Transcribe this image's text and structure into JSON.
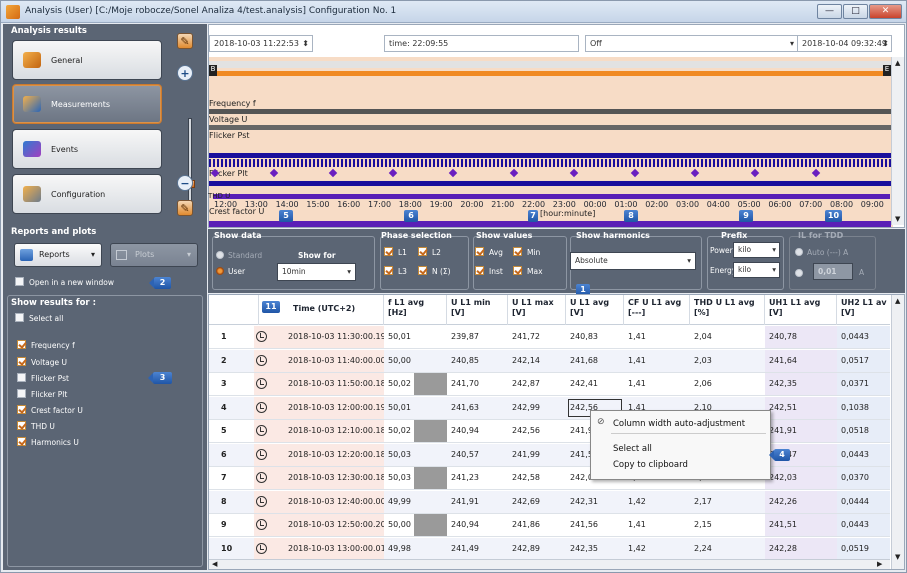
{
  "window": {
    "title": "Analysis (User) [C:/Moje robocze/Sonel Analiza 4/test.analysis] Configuration No. 1",
    "min": "—",
    "max": "□",
    "close": "✕"
  },
  "left": {
    "analysis_title": "Analysis results",
    "nav": [
      "General",
      "Measurements",
      "Events",
      "Configuration"
    ],
    "reports_title": "Reports and plots",
    "reports_btn": "Reports",
    "plots_btn": "Plots",
    "open_new_window": "Open in a new window",
    "show_results_title": "Show results for :",
    "select_all": "Select all",
    "params": [
      {
        "label": "Frequency f",
        "checked": true
      },
      {
        "label": "Voltage U",
        "checked": true
      },
      {
        "label": "Flicker Pst",
        "checked": false
      },
      {
        "label": "Flicker Plt",
        "checked": false
      },
      {
        "label": "Crest factor U",
        "checked": true
      },
      {
        "label": "THD U",
        "checked": true
      },
      {
        "label": "Harmonics U",
        "checked": true
      }
    ]
  },
  "timeline": {
    "start": "2018-10-03 11:22:53",
    "time": "time: 22:09:55",
    "mode": "Off",
    "end": "2018-10-04 09:32:49",
    "tracks": [
      "Frequency f",
      "Voltage U",
      "Flicker Pst",
      "Flicker Plt",
      "Crest factor U",
      "THD U"
    ],
    "hours": [
      "12:00",
      "13:00",
      "14:00",
      "15:00",
      "16:00",
      "17:00",
      "18:00",
      "19:00",
      "20:00",
      "21:00",
      "22:00",
      "23:00",
      "00:00",
      "01:00",
      "02:00",
      "03:00",
      "04:00",
      "05:00",
      "06:00",
      "07:00",
      "08:00",
      "09:00"
    ],
    "axis_unit": "[hour:minute]",
    "start_marker": "B",
    "end_marker": "E"
  },
  "options": {
    "show_data": "Show data",
    "standard": "Standard",
    "user": "User",
    "show_for": "Show for",
    "show_for_val": "10min",
    "phase_sel": "Phase selection",
    "l1": "L1",
    "l2": "L2",
    "l3": "L3",
    "n": "N (Σ)",
    "show_values": "Show values",
    "avg": "Avg",
    "min": "Min",
    "inst": "Inst",
    "max": "Max",
    "show_harm": "Show harmonics",
    "harm_val": "Absolute",
    "prefix": "Prefix",
    "power": "Power",
    "power_val": "kilo",
    "energy": "Energy",
    "energy_val": "kilo",
    "tdd": "IL for TDD",
    "auto": "Auto (---) A",
    "manual": "0,01",
    "manual_unit": "A"
  },
  "badges": [
    "1",
    "2",
    "3",
    "4",
    "5",
    "6",
    "7",
    "8",
    "9",
    "10",
    "11"
  ],
  "table": {
    "headers": [
      {
        "l1": "Time (UTC+2)",
        "l2": ""
      },
      {
        "l1": "f L1 avg",
        "l2": "[Hz]"
      },
      {
        "l1": "U L1 min",
        "l2": "[V]"
      },
      {
        "l1": "U L1 max",
        "l2": "[V]"
      },
      {
        "l1": "U L1 avg",
        "l2": "[V]"
      },
      {
        "l1": "CF U L1 avg",
        "l2": "[---]"
      },
      {
        "l1": "THD U L1 avg",
        "l2": "[%]"
      },
      {
        "l1": "UH1 L1 avg",
        "l2": "[V]"
      },
      {
        "l1": "UH2 L1 av",
        "l2": "[V]"
      }
    ],
    "rows": [
      [
        "1",
        "2018-10-03 11:30:00.195",
        "50,01",
        "239,87",
        "241,72",
        "240,83",
        "1,41",
        "2,04",
        "240,78",
        "0,0443"
      ],
      [
        "2",
        "2018-10-03 11:40:00.008",
        "50,00",
        "240,85",
        "242,14",
        "241,68",
        "1,41",
        "2,03",
        "241,64",
        "0,0517"
      ],
      [
        "3",
        "2018-10-03 11:50:00.189",
        "50,02",
        "241,70",
        "242,87",
        "242,41",
        "1,41",
        "2,06",
        "242,35",
        "0,0371"
      ],
      [
        "4",
        "2018-10-03 12:00:00.194",
        "50,01",
        "241,63",
        "242,99",
        "242,56",
        "1,41",
        "2,10",
        "242,51",
        "0,1038"
      ],
      [
        "5",
        "2018-10-03 12:10:00.187",
        "50,02",
        "240,94",
        "242,56",
        "241,96",
        "1,41",
        "2,12",
        "241,91",
        "0,0518"
      ],
      [
        "6",
        "2018-10-03 12:20:00.181",
        "50,03",
        "240,57",
        "241,99",
        "241,52",
        "1,41",
        "2,14",
        "241,47",
        "0,0443"
      ],
      [
        "7",
        "2018-10-03 12:30:00.182",
        "50,03",
        "241,23",
        "242,58",
        "242,08",
        "1,42",
        "2,15",
        "242,03",
        "0,0370"
      ],
      [
        "8",
        "2018-10-03 12:40:00.006",
        "49,99",
        "241,91",
        "242,69",
        "242,31",
        "1,42",
        "2,17",
        "242,26",
        "0,0444"
      ],
      [
        "9",
        "2018-10-03 12:50:00.200",
        "50,00",
        "240,94",
        "241,86",
        "241,56",
        "1,41",
        "2,15",
        "241,51",
        "0,0443"
      ],
      [
        "10",
        "2018-10-03 13:00:00.010",
        "49,98",
        "241,49",
        "242,89",
        "242,35",
        "1,42",
        "2,24",
        "242,28",
        "0,0519"
      ]
    ]
  },
  "context_menu": [
    "Column width auto-adjustment",
    "Select all",
    "Copy to clipboard"
  ]
}
